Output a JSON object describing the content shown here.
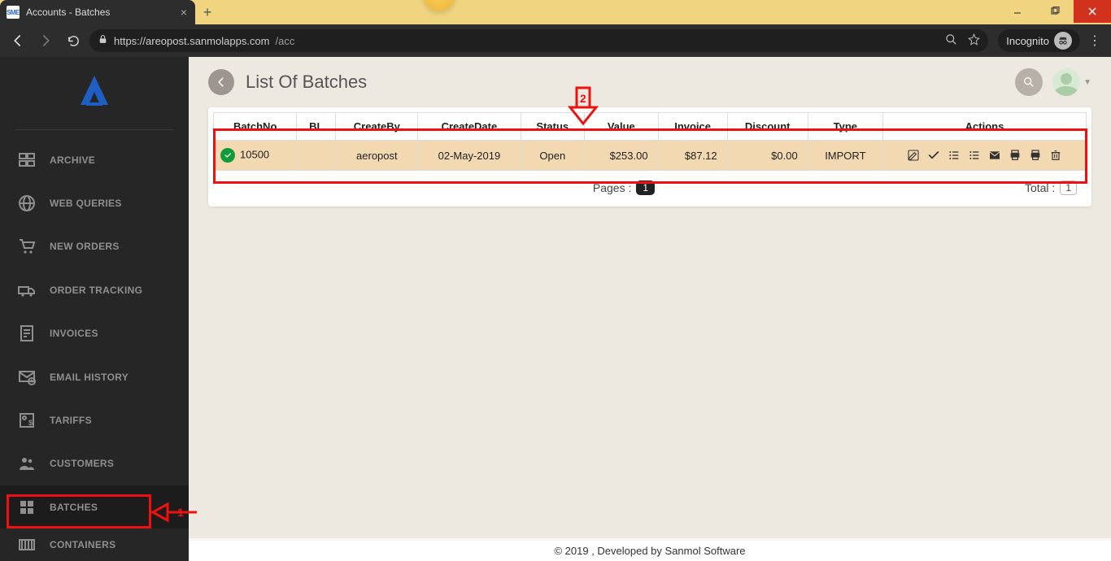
{
  "browser": {
    "tab_title": "Accounts - Batches",
    "url_host": "https://areopost.sanmolapps.com",
    "url_path": "/acc",
    "incognito_label": "Incognito"
  },
  "sidebar": {
    "items": [
      {
        "label": "ARCHIVE"
      },
      {
        "label": "WEB QUERIES"
      },
      {
        "label": "NEW ORDERS"
      },
      {
        "label": "ORDER TRACKING"
      },
      {
        "label": "INVOICES"
      },
      {
        "label": "EMAIL HISTORY"
      },
      {
        "label": "TARIFFS"
      },
      {
        "label": "CUSTOMERS"
      },
      {
        "label": "BATCHES"
      },
      {
        "label": "CONTAINERS"
      }
    ]
  },
  "header": {
    "title": "List Of Batches"
  },
  "table": {
    "columns": [
      "BatchNo",
      "BL",
      "CreateBy",
      "CreateDate",
      "Status",
      "Value",
      "Invoice",
      "Discount",
      "Type",
      "Actions"
    ],
    "rows": [
      {
        "batch_no": "10500",
        "bl": "",
        "create_by": "aeropost",
        "create_date": "02-May-2019",
        "status": "Open",
        "value": "$253.00",
        "invoice": "$87.12",
        "discount": "$0.00",
        "type": "IMPORT"
      }
    ]
  },
  "pagination": {
    "pages_label": "Pages :",
    "current_page": "1",
    "total_label": "Total :",
    "total_value": "1"
  },
  "footer": {
    "text": "© 2019 , Developed by Sanmol Software"
  },
  "annotations": {
    "callout1": "1",
    "callout2": "2"
  }
}
